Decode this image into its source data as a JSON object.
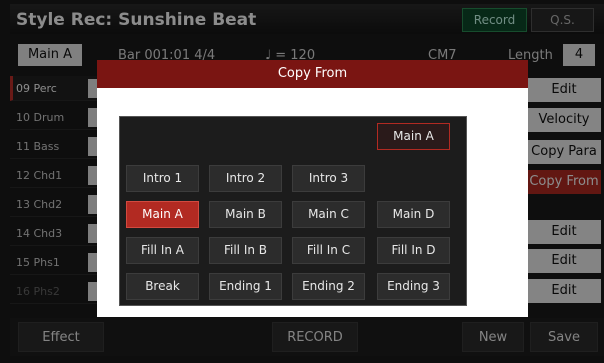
{
  "title": "Style Rec: Sunshine Beat",
  "top_tabs": {
    "record": "Record",
    "qs": "Q.S."
  },
  "info": {
    "section": "Main A",
    "bar_label": "Bar 001:01  4/4",
    "tempo": "♩ = 120",
    "chord": "CM7",
    "length_label": "Length",
    "length_value": "4"
  },
  "tracks": [
    "09 Perc",
    "10 Drum",
    "11 Bass",
    "12 Chd1",
    "13 Chd2",
    "14 Chd3",
    "15 Phs1",
    "16 Phs2"
  ],
  "right_buttons": {
    "edit_top": "Edit",
    "velocity": "Velocity",
    "copy_para": "Copy Para",
    "copy_from": "Copy From",
    "edit_1": "Edit",
    "edit_2": "Edit",
    "edit_3": "Edit"
  },
  "bottom": {
    "effect": "Effect",
    "record": "RECORD",
    "new": "New",
    "save": "Save"
  },
  "dialog": {
    "title": "Copy From",
    "target": "Main A",
    "rows": [
      [
        "Intro 1",
        "Intro 2",
        "Intro 3"
      ],
      [
        "Main A",
        "Main B",
        "Main C",
        "Main D"
      ],
      [
        "Fill In A",
        "Fill In B",
        "Fill In C",
        "Fill In D"
      ],
      [
        "Break",
        "Ending 1",
        "Ending 2",
        "Ending 3"
      ]
    ],
    "selected": "Main A"
  },
  "colors": {
    "accent": "#b22a22",
    "dialog_header": "#7a1512",
    "record_tab": "#0d4a2a"
  }
}
